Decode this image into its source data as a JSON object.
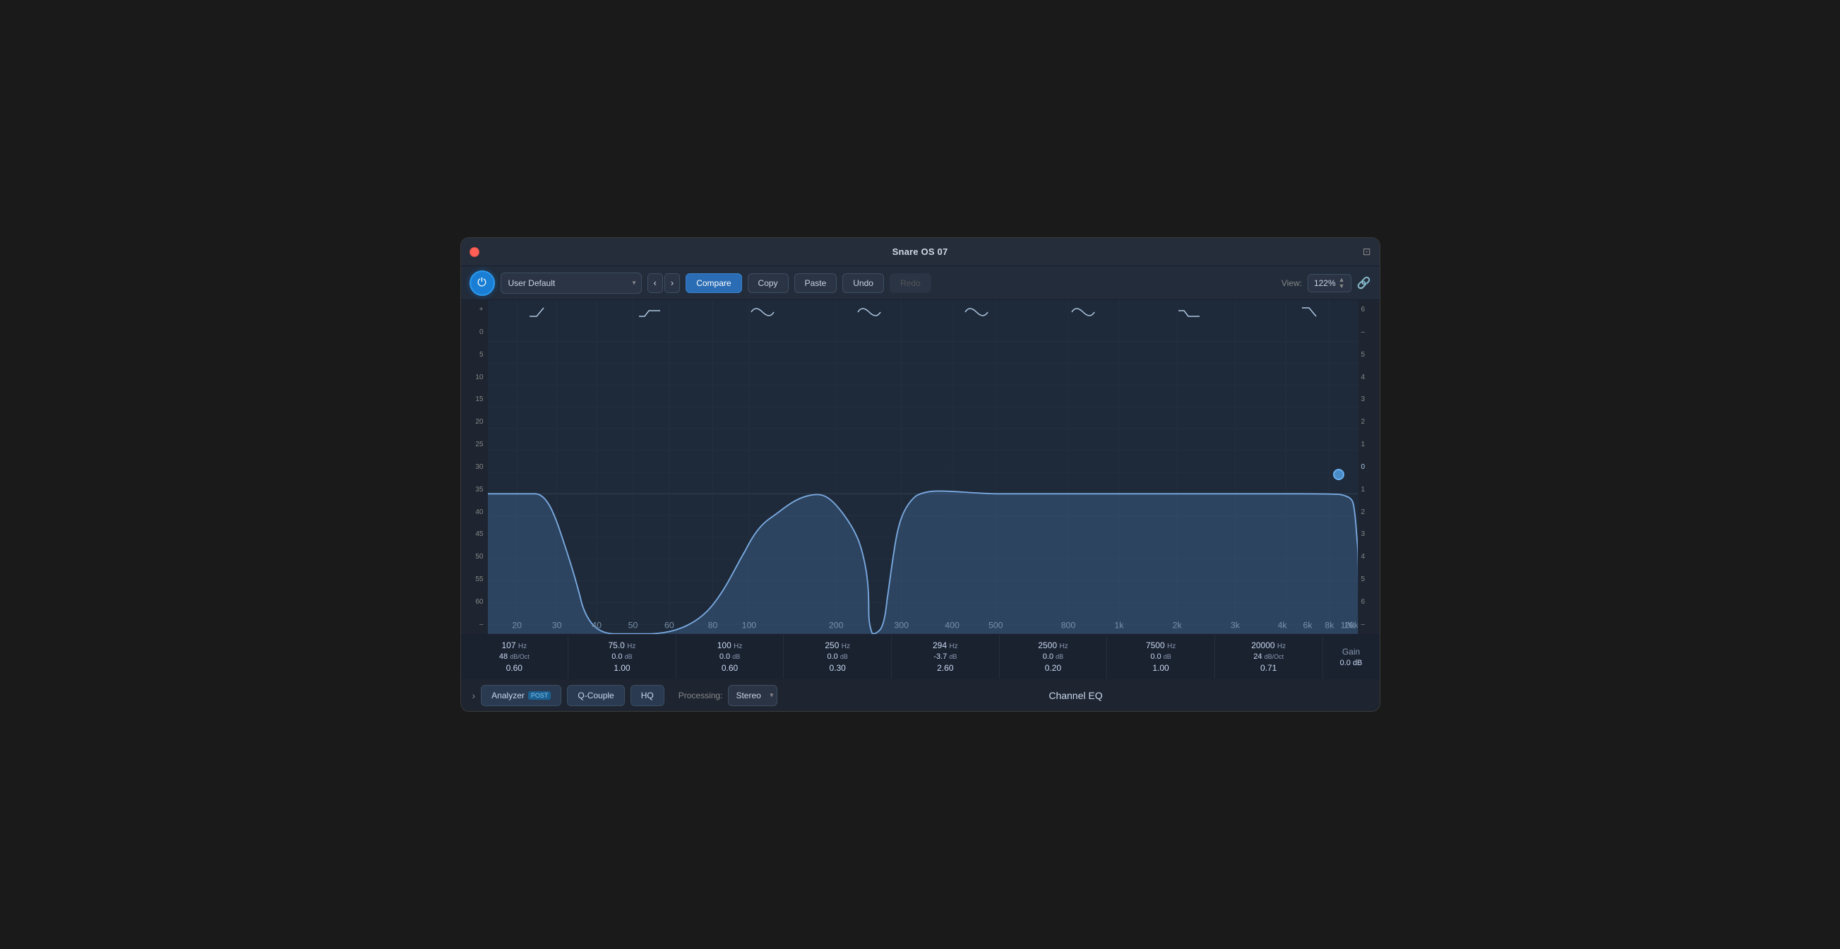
{
  "window": {
    "title": "Snare OS 07",
    "bottom_title": "Channel EQ"
  },
  "toolbar": {
    "preset": "User Default",
    "compare_label": "Compare",
    "copy_label": "Copy",
    "paste_label": "Paste",
    "undo_label": "Undo",
    "redo_label": "Redo",
    "view_label": "View:",
    "view_value": "122%",
    "nav_back": "‹",
    "nav_fwd": "›"
  },
  "bands": [
    {
      "freq": "107",
      "freq_unit": "Hz",
      "db": "48",
      "db_unit": "dB/Oct",
      "q": "0.60"
    },
    {
      "freq": "75.0",
      "freq_unit": "Hz",
      "db": "0.0",
      "db_unit": "dB",
      "q": "1.00"
    },
    {
      "freq": "100",
      "freq_unit": "Hz",
      "db": "0.0",
      "db_unit": "dB",
      "q": "0.60"
    },
    {
      "freq": "250",
      "freq_unit": "Hz",
      "db": "0.0",
      "db_unit": "dB",
      "q": "0.30"
    },
    {
      "freq": "294",
      "freq_unit": "Hz",
      "db": "-3.7",
      "db_unit": "dB",
      "q": "2.60"
    },
    {
      "freq": "2500",
      "freq_unit": "Hz",
      "db": "0.0",
      "db_unit": "dB",
      "q": "0.20"
    },
    {
      "freq": "7500",
      "freq_unit": "Hz",
      "db": "0.0",
      "db_unit": "dB",
      "q": "1.00"
    },
    {
      "freq": "20000",
      "freq_unit": "Hz",
      "db": "24",
      "db_unit": "dB/Oct",
      "q": "0.71"
    }
  ],
  "gain": {
    "label": "Gain",
    "value": "0.0 dB"
  },
  "bottom": {
    "analyzer_label": "Analyzer",
    "post_badge": "POST",
    "q_couple_label": "Q-Couple",
    "hq_label": "HQ",
    "processing_label": "Processing:",
    "processing_value": "Stereo",
    "chevron": "›"
  },
  "freq_labels": [
    "20",
    "30",
    "40",
    "50",
    "60",
    "80",
    "100",
    "200",
    "300",
    "400",
    "500",
    "800",
    "1k",
    "2k",
    "3k",
    "4k",
    "6k",
    "8k",
    "10k",
    "20k"
  ],
  "left_scale": [
    "+",
    "0",
    "5",
    "10",
    "15",
    "20",
    "25",
    "30",
    "35",
    "40",
    "45",
    "50",
    "55",
    "60",
    "–"
  ],
  "right_scale": [
    "6",
    "–",
    "5",
    "4",
    "3",
    "2",
    "1",
    "0",
    "1",
    "2",
    "3",
    "4",
    "5",
    "6",
    "–"
  ],
  "band_icons": [
    "high-pass",
    "low-shelf",
    "bell1",
    "bell2",
    "bell3",
    "bell4",
    "high-shelf",
    "low-pass"
  ]
}
